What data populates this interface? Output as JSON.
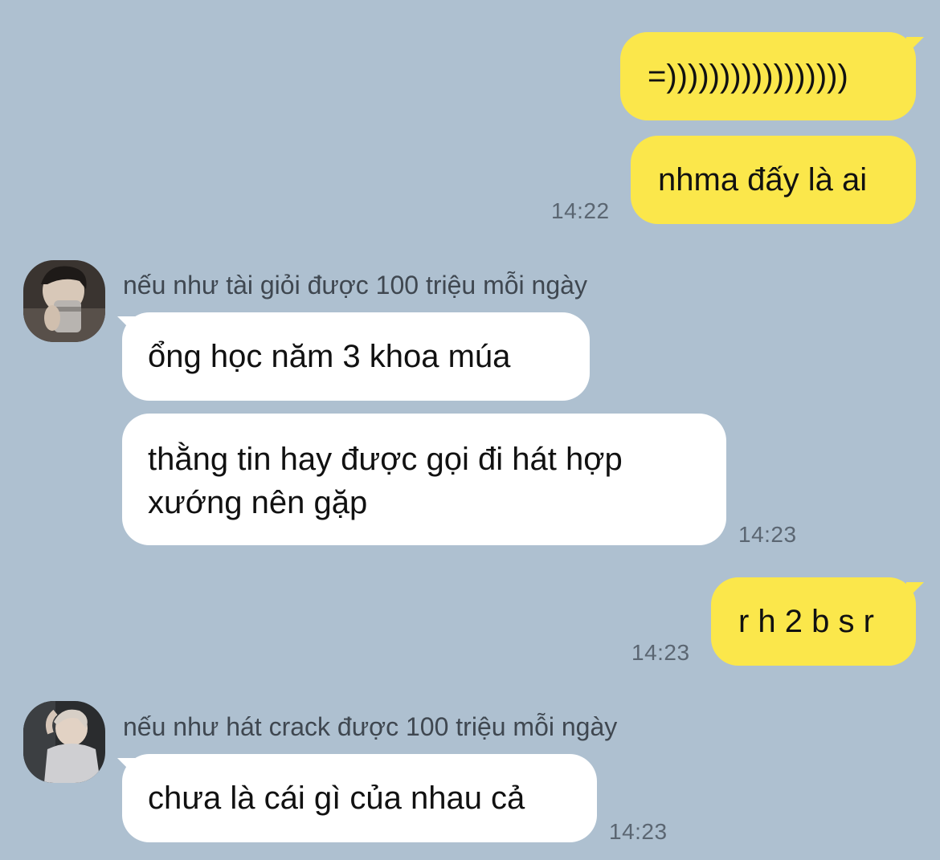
{
  "messages": [
    {
      "side": "mine",
      "text": "=)))))))))))))))))"
    },
    {
      "side": "mine",
      "text": "nhma đấy là ai",
      "time": "14:22"
    },
    {
      "side": "theirs",
      "sender": "nếu như tài giỏi được 100 triệu mỗi ngày",
      "avatar": "profile-photo-avatar",
      "text": "ổng học năm 3 khoa múa"
    },
    {
      "side": "theirs",
      "text_line1": "thằng tin hay được gọi đi hát hợp",
      "text_line2": "xướng nên gặp",
      "time": "14:23"
    },
    {
      "side": "mine",
      "text": "r h 2 b s r",
      "time": "14:23"
    },
    {
      "side": "theirs",
      "sender": "nếu như hát crack được 100 triệu mỗi ngày",
      "avatar": "profile-photo-avatar",
      "text": "chưa là cái gì của nhau cả",
      "time": "14:23"
    }
  ],
  "colors": {
    "background": "#aec0d0",
    "my_bubble": "#fbe74b",
    "their_bubble": "#ffffff"
  }
}
